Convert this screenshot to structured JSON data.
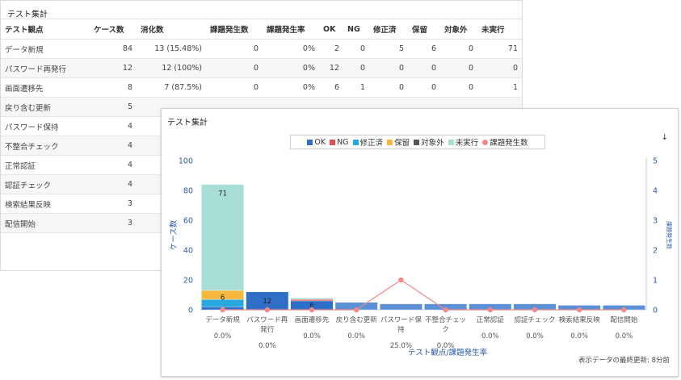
{
  "table_panel": {
    "title": "テスト集計",
    "columns": [
      "テスト観点",
      "ケース数",
      "消化数",
      "課題発生数",
      "課題発生率",
      "OK",
      "NG",
      "修正済",
      "保留",
      "対象外",
      "未実行"
    ],
    "rows": [
      [
        "データ新規",
        "84",
        "13 (15.48%)",
        "0",
        "0%",
        "2",
        "0",
        "5",
        "6",
        "0",
        "71"
      ],
      [
        "パスワード再発行",
        "12",
        "12 (100%)",
        "0",
        "0%",
        "12",
        "0",
        "0",
        "0",
        "0",
        "0"
      ],
      [
        "画面遷移先",
        "8",
        "7 (87.5%)",
        "0",
        "0%",
        "6",
        "1",
        "0",
        "0",
        "0",
        "1"
      ],
      [
        "戻り含む更新",
        "5",
        "",
        "",
        "",
        "",
        "",
        "",
        "",
        "",
        ""
      ],
      [
        "パスワード保持",
        "4",
        "",
        "",
        "",
        "",
        "",
        "",
        "",
        "",
        ""
      ],
      [
        "不整合チェック",
        "4",
        "",
        "",
        "",
        "",
        "",
        "",
        "",
        "",
        ""
      ],
      [
        "正常認証",
        "4",
        "",
        "",
        "",
        "",
        "",
        "",
        "",
        "",
        ""
      ],
      [
        "認証チェック",
        "4",
        "",
        "",
        "",
        "",
        "",
        "",
        "",
        "",
        ""
      ],
      [
        "検索結果反映",
        "3",
        "",
        "",
        "",
        "",
        "",
        "",
        "",
        "",
        ""
      ],
      [
        "配信開始",
        "3",
        "",
        "",
        "",
        "",
        "",
        "",
        "",
        "",
        ""
      ]
    ]
  },
  "chart_panel": {
    "title": "テスト集計",
    "download_icon": "↓",
    "footer": "表示データの最終更新: 8分前"
  },
  "chart_data": {
    "type": "bar",
    "stacked": true,
    "legend_position": "top-center",
    "categories": [
      [
        "データ新規"
      ],
      [
        "パスワード再",
        "発行"
      ],
      [
        "画面遷移先"
      ],
      [
        "戻り含む更新"
      ],
      [
        "パスワード保",
        "持"
      ],
      [
        "不整合チェッ",
        "ク"
      ],
      [
        "正常認証"
      ],
      [
        "認証チェック"
      ],
      [
        "検索結果反映"
      ],
      [
        "配信開始"
      ]
    ],
    "rate_labels": [
      "0.0%",
      "0.0%",
      "0.0%",
      "0.0%",
      "25.0%",
      "0.0%",
      "0.0%",
      "0.0%",
      "0.0%",
      "0.0%"
    ],
    "series": [
      {
        "name": "OK",
        "color": "#2f6fc7",
        "values": [
          2,
          12,
          6,
          0,
          0,
          0,
          0,
          0,
          0,
          0
        ]
      },
      {
        "name": "NG",
        "color": "#d9534f",
        "values": [
          0,
          0,
          1,
          0,
          0,
          0,
          0,
          0,
          0,
          0
        ]
      },
      {
        "name": "修正済",
        "color": "#29a8e0",
        "values": [
          5,
          0,
          0,
          0,
          0,
          0,
          0,
          0,
          0,
          0
        ]
      },
      {
        "name": "保留",
        "color": "#f6b73c",
        "values": [
          6,
          0,
          0,
          0,
          0,
          0,
          0,
          0,
          0,
          0
        ]
      },
      {
        "name": "対象外",
        "color": "#555555",
        "values": [
          0,
          0,
          0,
          0,
          0,
          0,
          0,
          0,
          0,
          0
        ]
      },
      {
        "name": "未実行",
        "color": "#a8ded6",
        "values": [
          71,
          0,
          1,
          0,
          0,
          0,
          0,
          0,
          0,
          0
        ]
      }
    ],
    "line_series": {
      "name": "課題発生数",
      "color": "#f08a8a",
      "values": [
        0,
        0,
        0,
        0,
        1,
        0,
        0,
        0,
        0,
        0
      ]
    },
    "case_totals": [
      84,
      12,
      8,
      5,
      4,
      4,
      4,
      4,
      3,
      3
    ],
    "bar_labels": [
      "71",
      "6",
      "12",
      "6",
      "",
      "",
      "",
      "",
      "",
      ""
    ],
    "bar_label_values": [
      [
        71,
        6
      ],
      [
        12
      ],
      [
        6
      ],
      [],
      [],
      [],
      [],
      [],
      [],
      []
    ],
    "y_left": {
      "label": "ケース数",
      "ticks": [
        "0",
        "20",
        "40",
        "60",
        "80",
        "100"
      ],
      "lim": [
        0,
        100
      ]
    },
    "y_right": {
      "label": "課題発生数",
      "ticks": [
        "0",
        "1",
        "2",
        "3",
        "4",
        "5"
      ],
      "lim": [
        0,
        5
      ]
    },
    "xlabel": "テスト観点/課題発生率"
  }
}
